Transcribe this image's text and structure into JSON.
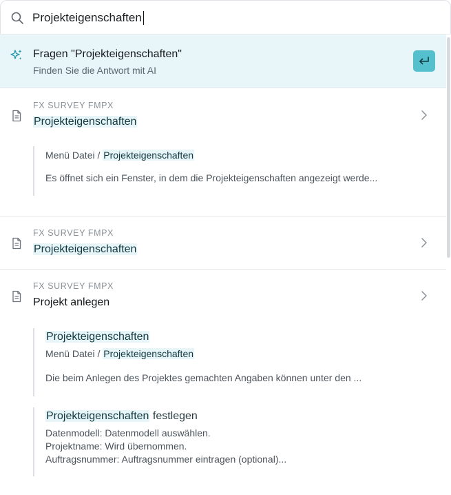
{
  "search": {
    "query": "Projekteigenschaften",
    "icon": "search-icon"
  },
  "ask": {
    "title": "Fragen \"Projekteigenschaften\"",
    "subtitle": "Finden Sie die Antwort mit AI",
    "icon": "sparkle-icon",
    "enter_icon": "enter-icon",
    "accent_color": "#54bfcd",
    "background_color": "#e8f6f9"
  },
  "results": [
    {
      "source": "FX SURVEY FMPX",
      "title": "Projekteigenschaften",
      "snippets": [
        {
          "path_prefix": "Menü Datei / ",
          "path_highlight": "Projekteigenschaften",
          "text": "Es öffnet sich ein Fenster, in dem die Projekteigenschaften angezeigt werde..."
        }
      ]
    },
    {
      "source": "FX SURVEY FMPX",
      "title": "Projekteigenschaften",
      "snippets": []
    },
    {
      "source": "FX SURVEY FMPX",
      "title": "Projekt anlegen",
      "snippets": [
        {
          "heading_highlight": "Projekteigenschaften",
          "path_prefix": "Menü Datei / ",
          "path_highlight": "Projekteigenschaften",
          "text": "Die beim Anlegen des Projektes gemachten Angaben können unter den ..."
        },
        {
          "heading_highlight": "Projekteigenschaften",
          "heading_rest": " festlegen",
          "lines": [
            "Datenmodell: Datenmodell auswählen.",
            "Projektname: Wird übernommen.",
            "Auftragsnummer: Auftragsnummer eintragen (optional)..."
          ]
        }
      ]
    }
  ]
}
